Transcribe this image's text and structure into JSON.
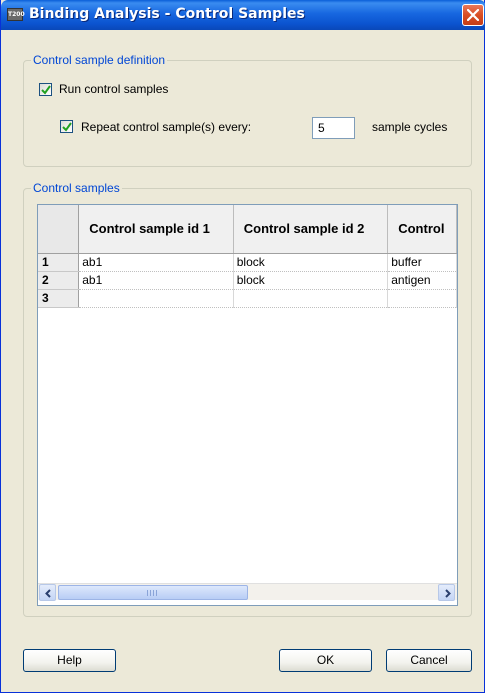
{
  "window": {
    "title": "Binding Analysis - Control Samples",
    "icon_text": "T200"
  },
  "definition_group": {
    "legend": "Control sample definition",
    "run_control": {
      "label": "Run control samples",
      "checked": true
    },
    "repeat": {
      "label": "Repeat control sample(s) every:",
      "checked": true,
      "value": "5",
      "suffix": "sample cycles"
    }
  },
  "samples_group": {
    "legend": "Control samples",
    "columns": [
      "Control sample id 1",
      "Control sample id 2",
      "Control"
    ],
    "rows": [
      {
        "num": "1",
        "cells": [
          "ab1",
          "block",
          "buffer"
        ]
      },
      {
        "num": "2",
        "cells": [
          "ab1",
          "block",
          "antigen"
        ]
      },
      {
        "num": "3",
        "cells": [
          "",
          "",
          ""
        ]
      }
    ]
  },
  "buttons": {
    "help": "Help",
    "ok": "OK",
    "cancel": "Cancel"
  }
}
